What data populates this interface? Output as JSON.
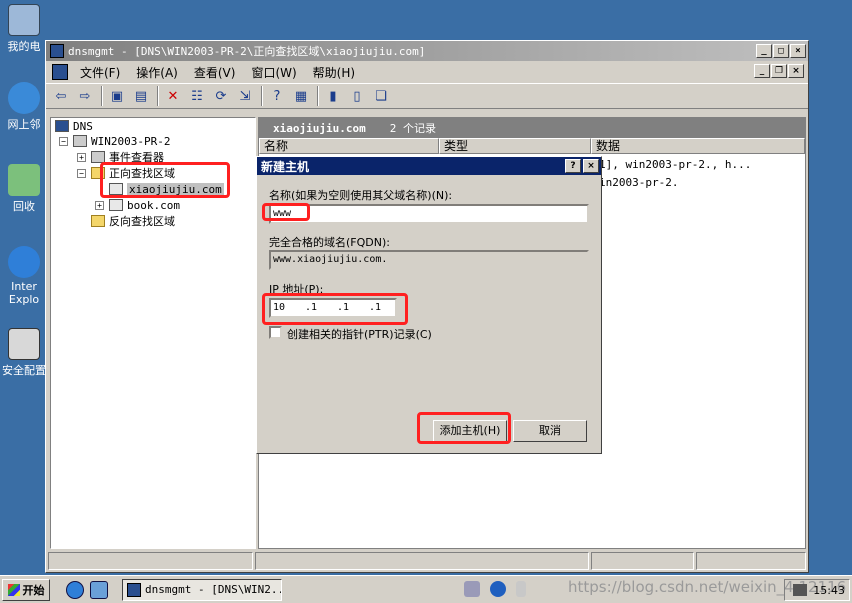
{
  "desktop": {
    "icons": [
      {
        "label": "我的电"
      },
      {
        "label": "网上邻"
      },
      {
        "label": "回收"
      },
      {
        "label": "Inter"
      },
      {
        "label": "Explo"
      },
      {
        "label": "安全配置"
      }
    ]
  },
  "window": {
    "title": "dnsmgmt - [DNS\\WIN2003-PR-2\\正向查找区域\\xiaojiujiu.com]",
    "menu": [
      "文件(F)",
      "操作(A)",
      "查看(V)",
      "窗口(W)",
      "帮助(H)"
    ],
    "tree": {
      "root": "DNS",
      "server": "WIN2003-PR-2",
      "event_viewer": "事件查看器",
      "forward_zones": "正向查找区域",
      "zone_selected": "xiaojiujiu.com",
      "zone_other": "book.com",
      "reverse_zones": "反向查找区域"
    },
    "right_pane": {
      "zone_name": "xiaojiujiu.com",
      "record_count": "2 个记录",
      "columns": [
        "名称",
        "类型",
        "数据"
      ],
      "rows": [
        {
          "data": "1], win2003-pr-2., h..."
        },
        {
          "data": "in2003-pr-2."
        }
      ]
    }
  },
  "dialog": {
    "title": "新建主机",
    "help_btn": "?",
    "close_btn": "×",
    "name_label": "名称(如果为空则使用其父域名称)(N):",
    "name_value": "www",
    "fqdn_label": "完全合格的域名(FQDN):",
    "fqdn_value": "www.xiaojiujiu.com.",
    "ip_label": "IP 地址(P):",
    "ip_segments": [
      "10",
      ".1",
      ".1",
      ".1"
    ],
    "ptr_label": "创建相关的指针(PTR)记录(C)",
    "add_button": "添加主机(H)",
    "cancel_button": "取消"
  },
  "taskbar": {
    "start": "开始",
    "task_button": "dnsmgmt - [DNS\\WIN2...",
    "watermark": "https://blog.csdn.net/weixin_4 12116",
    "clock": "15:43"
  }
}
